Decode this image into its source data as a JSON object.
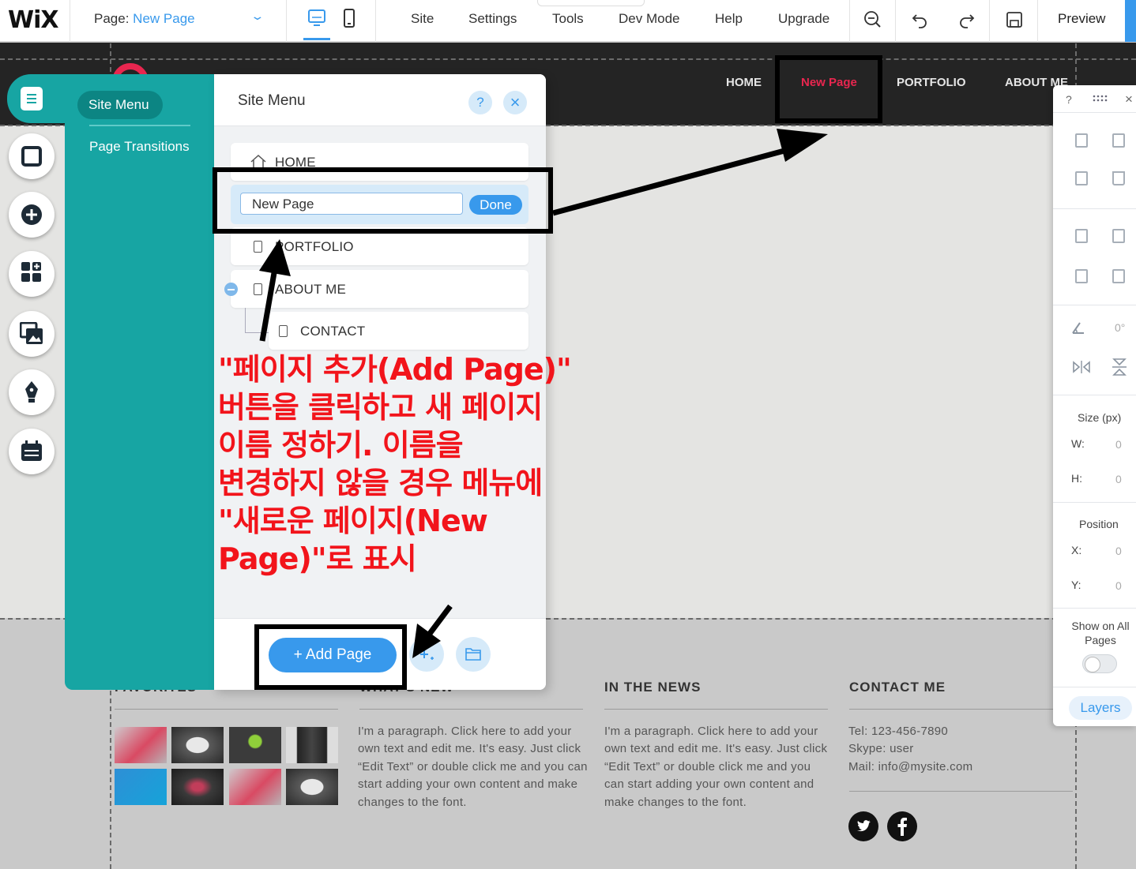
{
  "topbar": {
    "logo": "WiX",
    "page_label": "Page:",
    "page_value": "New Page",
    "menu": [
      "Site",
      "Settings",
      "Tools",
      "Dev Mode",
      "Help",
      "Upgrade"
    ],
    "preview_label": "Preview",
    "accent": "#3899ec"
  },
  "site": {
    "nav": [
      "HOME",
      "New Page",
      "PORTFOLIO",
      "ABOUT ME"
    ],
    "nav_active_color": "#e8264f",
    "footer": {
      "col1_heading": "FAVORITES",
      "col2_heading": "WHAT'S NEW",
      "col3_heading": "IN THE NEWS",
      "col4_heading": "CONTACT ME",
      "col2_text": "I'm a paragraph. Click here to add your own text and edit me. It's easy. Just click “Edit Text” or double click me and you can start adding your own content and make changes to the font.",
      "col3_text": "I'm a paragraph. Click here to add your own text and edit me. It's easy. Just click “Edit Text” or double click me and you can start adding your own content and make changes to the font.",
      "contact_lines": [
        "Tel: 123-456-7890",
        "Skype: user",
        "Mail: info@mysite.com"
      ],
      "social_icons": [
        "twitter-icon",
        "facebook-icon"
      ]
    }
  },
  "panel": {
    "tab_site_menu": "Site Menu",
    "tab_page_transitions": "Page Transitions",
    "title": "Site Menu",
    "help": "?",
    "close": "×",
    "pages": [
      {
        "label": "HOME"
      },
      {
        "label": "PORTFOLIO"
      },
      {
        "label": "ABOUT ME"
      },
      {
        "label": "CONTACT"
      }
    ],
    "edit_value": "New Page",
    "done_label": "Done",
    "add_page_label": "+ Add Page",
    "teal": "#17a5a3"
  },
  "inspector": {
    "help": "?",
    "rotation": "0°",
    "size_label": "Size (px)",
    "w_label": "W:",
    "w_value": "0",
    "h_label": "H:",
    "h_value": "0",
    "position_label": "Position",
    "x_label": "X:",
    "x_value": "0",
    "y_label": "Y:",
    "y_value": "0",
    "show_on_all_pages": "Show on All Pages",
    "layers_label": "Layers"
  },
  "annotation": {
    "text": "\"페이지 추가(Add Page)\"\n버튼을 클릭하고 새 페이지\n이름 정하기. 이름을\n변경하지 않을 경우 메뉴에\n\"새로운 페이지(New\nPage)\"로 표시",
    "color": "#f2141b"
  }
}
